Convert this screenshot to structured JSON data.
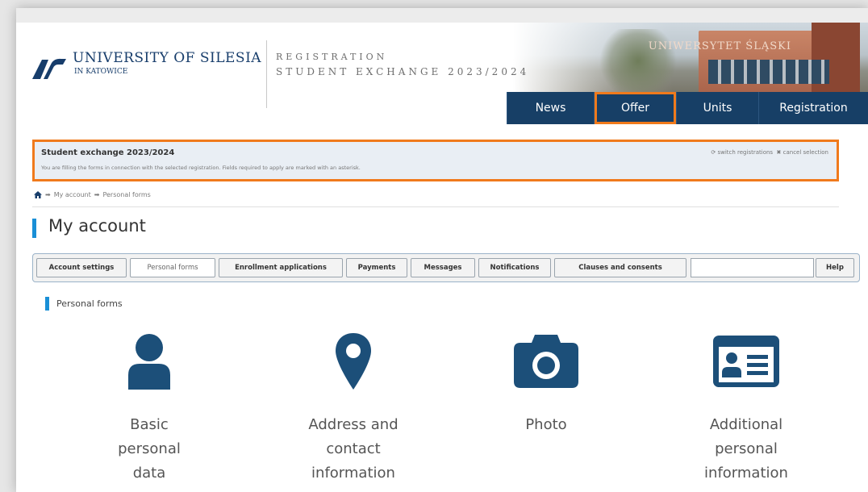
{
  "header": {
    "university_name": "UNIVERSITY OF SILESIA",
    "university_sub": "IN KATOWICE",
    "registration_line1": "REGISTRATION",
    "registration_line2": "STUDENT EXCHANGE 2023/2024",
    "photo_sign": "UNIWERSYTET ŚLĄSKI"
  },
  "nav": {
    "items": [
      {
        "label": "News"
      },
      {
        "label": "Offer",
        "highlighted": true
      },
      {
        "label": "Units"
      },
      {
        "label": "Registration"
      }
    ]
  },
  "banner": {
    "title": "Student exchange 2023/2024",
    "description": "You are filling the forms in connection with the selected registration. Fields required to apply are marked with an asterisk.",
    "switch_label": "switch registrations",
    "cancel_label": "cancel selection"
  },
  "breadcrumb": {
    "items": [
      "My account",
      "Personal forms"
    ]
  },
  "page": {
    "title": "My account"
  },
  "tabs": [
    {
      "label": "Account settings"
    },
    {
      "label": "Personal forms",
      "active": true
    },
    {
      "label": "Enrollment applications"
    },
    {
      "label": "Payments"
    },
    {
      "label": "Messages"
    },
    {
      "label": "Notifications"
    },
    {
      "label": "Clauses and consents"
    },
    {
      "label": "Help"
    }
  ],
  "section": {
    "title": "Personal forms"
  },
  "forms": [
    {
      "label_lines": [
        "Basic",
        "personal",
        "data"
      ],
      "icon": "user-icon"
    },
    {
      "label_lines": [
        "Address and",
        "contact",
        "information"
      ],
      "icon": "map-marker-icon"
    },
    {
      "label_lines": [
        "Photo"
      ],
      "icon": "camera-icon"
    },
    {
      "label_lines": [
        "Additional",
        "personal",
        "information"
      ],
      "icon": "id-card-icon"
    }
  ],
  "colors": {
    "nav_background": "#173f66",
    "accent_blue": "#1a8fd6",
    "icon_blue": "#1c4f79",
    "highlight_orange": "#f07a1c"
  }
}
